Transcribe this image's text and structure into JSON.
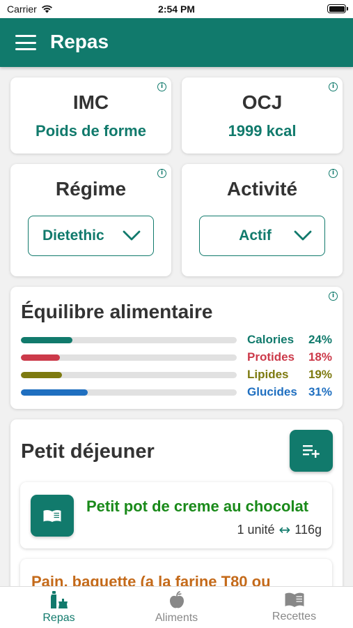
{
  "status_bar": {
    "carrier": "Carrier",
    "time": "2:54 PM"
  },
  "header": {
    "title": "Repas"
  },
  "imc": {
    "title": "IMC",
    "value": "Poids de forme"
  },
  "ocj": {
    "title": "OCJ",
    "value": "1999 kcal"
  },
  "regime": {
    "title": "Régime",
    "selected": "Dietethic"
  },
  "activite": {
    "title": "Activité",
    "selected": "Actif"
  },
  "equilibre": {
    "title": "Équilibre alimentaire",
    "rows": [
      {
        "label": "Calories",
        "percent_text": "24%",
        "fraction": 0.24,
        "color": "#117a6c"
      },
      {
        "label": "Protides",
        "percent_text": "18%",
        "fraction": 0.18,
        "color": "#cc3a4a"
      },
      {
        "label": "Lipides",
        "percent_text": "19%",
        "fraction": 0.19,
        "color": "#7d7a10"
      },
      {
        "label": "Glucides",
        "percent_text": "31%",
        "fraction": 0.31,
        "color": "#1f6fc0"
      }
    ]
  },
  "meal": {
    "title": "Petit déjeuner",
    "items": [
      {
        "name": "Petit pot de creme au chocolat",
        "quantity": "1 unité",
        "weight": "116g"
      },
      {
        "name": "Pain, baguette (a la farine T80 ou"
      }
    ]
  },
  "tabs": [
    {
      "label": "Repas",
      "icon": "bottles-icon",
      "active": true
    },
    {
      "label": "Aliments",
      "icon": "apple-icon",
      "active": false
    },
    {
      "label": "Recettes",
      "icon": "book-icon",
      "active": false
    }
  ],
  "colors": {
    "primary": "#117a6c",
    "food_green": "#1a8a1a",
    "food_orange": "#c46a1a"
  }
}
